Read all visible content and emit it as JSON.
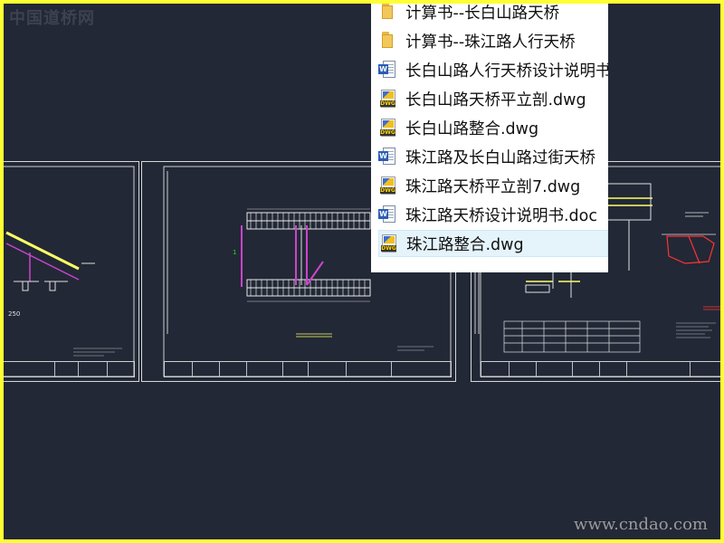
{
  "watermarks": {
    "top_left": "中国道桥网",
    "bottom_right": "www.cndao.com"
  },
  "file_list": {
    "items": [
      {
        "label": "计算书--长白山路天桥",
        "icon": "folder-icon",
        "type": "folder"
      },
      {
        "label": "计算书--珠江路人行天桥",
        "icon": "folder-icon",
        "type": "folder"
      },
      {
        "label": "长白山路人行天桥设计说明书",
        "icon": "word-doc-icon",
        "type": "doc"
      },
      {
        "label": "长白山路天桥平立剖.dwg",
        "icon": "dwg-file-icon",
        "type": "dwg"
      },
      {
        "label": "长白山路整合.dwg",
        "icon": "dwg-file-icon",
        "type": "dwg"
      },
      {
        "label": "珠江路及长白山路过街天桥",
        "icon": "word-doc-icon",
        "type": "doc"
      },
      {
        "label": "珠江路天桥平立剖7.dwg",
        "icon": "dwg-file-icon",
        "type": "dwg"
      },
      {
        "label": "珠江路天桥设计说明书.doc",
        "icon": "word-doc-icon",
        "type": "doc"
      },
      {
        "label": "珠江路整合.dwg",
        "icon": "dwg-file-icon",
        "type": "dwg",
        "selected": true
      }
    ]
  },
  "colors": {
    "frame": "#ffff33",
    "canvas": "#222836",
    "selection": "#e5f3fb"
  }
}
